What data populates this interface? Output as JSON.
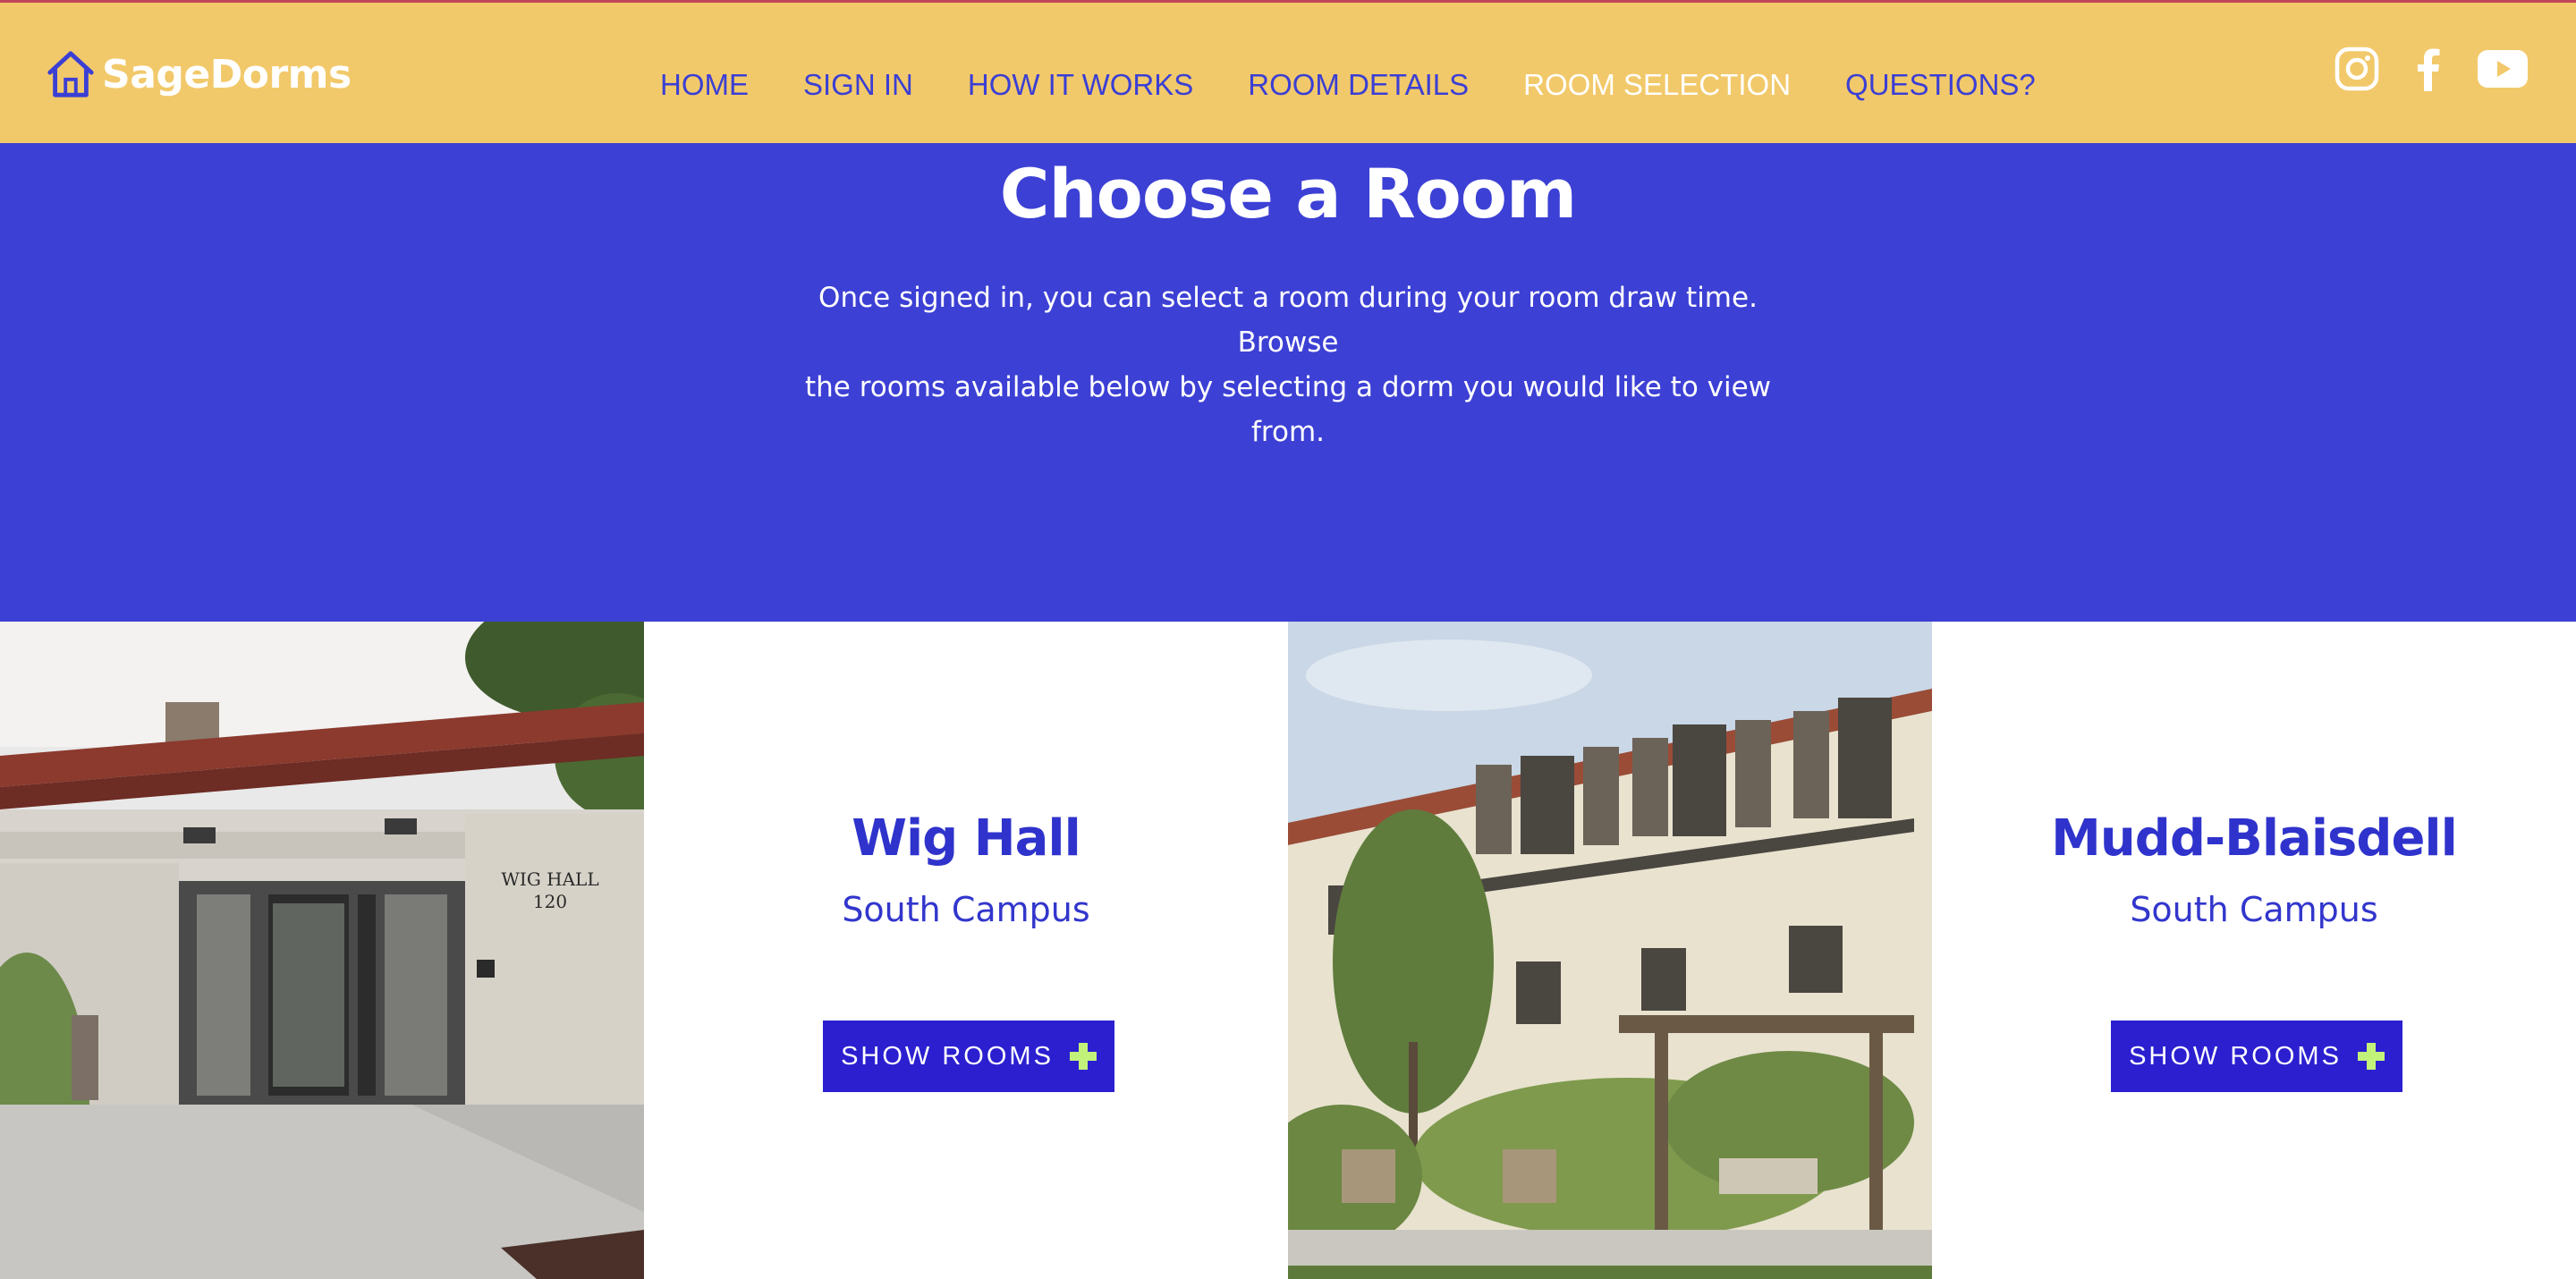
{
  "brand": {
    "name": "SageDorms",
    "icon": "house-icon"
  },
  "nav": {
    "items": [
      {
        "label": "HOME"
      },
      {
        "label": "SIGN IN"
      },
      {
        "label": "HOW IT WORKS"
      },
      {
        "label": "ROOM DETAILS"
      },
      {
        "label": "ROOM SELECTION"
      },
      {
        "label": "QUESTIONS?"
      }
    ],
    "active_item": "ROOM SELECTION"
  },
  "social": [
    "instagram-icon",
    "facebook-icon",
    "youtube-icon"
  ],
  "hero": {
    "title": "Choose a Room",
    "description_line1": "Once signed in, you can select a room during your room draw time. Browse",
    "description_line2": "the rooms available below by selecting a dorm you would like to view from."
  },
  "dorms": [
    {
      "name": "Wig Hall",
      "campus": "South Campus",
      "button_label": "SHOW ROOMS",
      "photo_sign": "WIG HALL 120"
    },
    {
      "name": "Mudd-Blaisdell",
      "campus": "South Campus",
      "button_label": "SHOW ROOMS"
    }
  ],
  "colors": {
    "header_bg": "#f2c96a",
    "hero_bg": "#3c40d4",
    "nav_text": "#3b3fd4",
    "button_bg": "#2b1fd0",
    "plus": "#c3f27a"
  }
}
